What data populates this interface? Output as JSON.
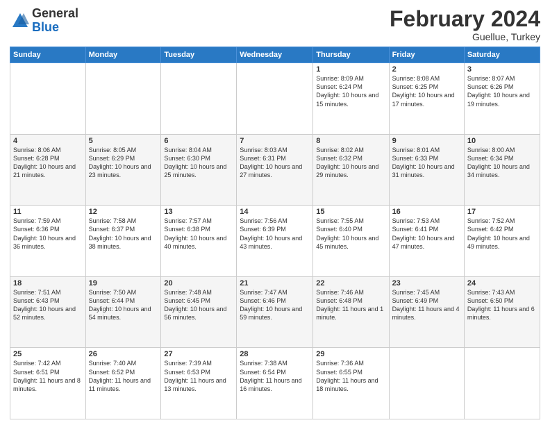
{
  "header": {
    "logo_general": "General",
    "logo_blue": "Blue",
    "month_title": "February 2024",
    "subtitle": "Guellue, Turkey"
  },
  "weekdays": [
    "Sunday",
    "Monday",
    "Tuesday",
    "Wednesday",
    "Thursday",
    "Friday",
    "Saturday"
  ],
  "weeks": [
    [
      {
        "day": "",
        "sunrise": "",
        "sunset": "",
        "daylight": ""
      },
      {
        "day": "",
        "sunrise": "",
        "sunset": "",
        "daylight": ""
      },
      {
        "day": "",
        "sunrise": "",
        "sunset": "",
        "daylight": ""
      },
      {
        "day": "",
        "sunrise": "",
        "sunset": "",
        "daylight": ""
      },
      {
        "day": "1",
        "sunrise": "Sunrise: 8:09 AM",
        "sunset": "Sunset: 6:24 PM",
        "daylight": "Daylight: 10 hours and 15 minutes."
      },
      {
        "day": "2",
        "sunrise": "Sunrise: 8:08 AM",
        "sunset": "Sunset: 6:25 PM",
        "daylight": "Daylight: 10 hours and 17 minutes."
      },
      {
        "day": "3",
        "sunrise": "Sunrise: 8:07 AM",
        "sunset": "Sunset: 6:26 PM",
        "daylight": "Daylight: 10 hours and 19 minutes."
      }
    ],
    [
      {
        "day": "4",
        "sunrise": "Sunrise: 8:06 AM",
        "sunset": "Sunset: 6:28 PM",
        "daylight": "Daylight: 10 hours and 21 minutes."
      },
      {
        "day": "5",
        "sunrise": "Sunrise: 8:05 AM",
        "sunset": "Sunset: 6:29 PM",
        "daylight": "Daylight: 10 hours and 23 minutes."
      },
      {
        "day": "6",
        "sunrise": "Sunrise: 8:04 AM",
        "sunset": "Sunset: 6:30 PM",
        "daylight": "Daylight: 10 hours and 25 minutes."
      },
      {
        "day": "7",
        "sunrise": "Sunrise: 8:03 AM",
        "sunset": "Sunset: 6:31 PM",
        "daylight": "Daylight: 10 hours and 27 minutes."
      },
      {
        "day": "8",
        "sunrise": "Sunrise: 8:02 AM",
        "sunset": "Sunset: 6:32 PM",
        "daylight": "Daylight: 10 hours and 29 minutes."
      },
      {
        "day": "9",
        "sunrise": "Sunrise: 8:01 AM",
        "sunset": "Sunset: 6:33 PM",
        "daylight": "Daylight: 10 hours and 31 minutes."
      },
      {
        "day": "10",
        "sunrise": "Sunrise: 8:00 AM",
        "sunset": "Sunset: 6:34 PM",
        "daylight": "Daylight: 10 hours and 34 minutes."
      }
    ],
    [
      {
        "day": "11",
        "sunrise": "Sunrise: 7:59 AM",
        "sunset": "Sunset: 6:36 PM",
        "daylight": "Daylight: 10 hours and 36 minutes."
      },
      {
        "day": "12",
        "sunrise": "Sunrise: 7:58 AM",
        "sunset": "Sunset: 6:37 PM",
        "daylight": "Daylight: 10 hours and 38 minutes."
      },
      {
        "day": "13",
        "sunrise": "Sunrise: 7:57 AM",
        "sunset": "Sunset: 6:38 PM",
        "daylight": "Daylight: 10 hours and 40 minutes."
      },
      {
        "day": "14",
        "sunrise": "Sunrise: 7:56 AM",
        "sunset": "Sunset: 6:39 PM",
        "daylight": "Daylight: 10 hours and 43 minutes."
      },
      {
        "day": "15",
        "sunrise": "Sunrise: 7:55 AM",
        "sunset": "Sunset: 6:40 PM",
        "daylight": "Daylight: 10 hours and 45 minutes."
      },
      {
        "day": "16",
        "sunrise": "Sunrise: 7:53 AM",
        "sunset": "Sunset: 6:41 PM",
        "daylight": "Daylight: 10 hours and 47 minutes."
      },
      {
        "day": "17",
        "sunrise": "Sunrise: 7:52 AM",
        "sunset": "Sunset: 6:42 PM",
        "daylight": "Daylight: 10 hours and 49 minutes."
      }
    ],
    [
      {
        "day": "18",
        "sunrise": "Sunrise: 7:51 AM",
        "sunset": "Sunset: 6:43 PM",
        "daylight": "Daylight: 10 hours and 52 minutes."
      },
      {
        "day": "19",
        "sunrise": "Sunrise: 7:50 AM",
        "sunset": "Sunset: 6:44 PM",
        "daylight": "Daylight: 10 hours and 54 minutes."
      },
      {
        "day": "20",
        "sunrise": "Sunrise: 7:48 AM",
        "sunset": "Sunset: 6:45 PM",
        "daylight": "Daylight: 10 hours and 56 minutes."
      },
      {
        "day": "21",
        "sunrise": "Sunrise: 7:47 AM",
        "sunset": "Sunset: 6:46 PM",
        "daylight": "Daylight: 10 hours and 59 minutes."
      },
      {
        "day": "22",
        "sunrise": "Sunrise: 7:46 AM",
        "sunset": "Sunset: 6:48 PM",
        "daylight": "Daylight: 11 hours and 1 minute."
      },
      {
        "day": "23",
        "sunrise": "Sunrise: 7:45 AM",
        "sunset": "Sunset: 6:49 PM",
        "daylight": "Daylight: 11 hours and 4 minutes."
      },
      {
        "day": "24",
        "sunrise": "Sunrise: 7:43 AM",
        "sunset": "Sunset: 6:50 PM",
        "daylight": "Daylight: 11 hours and 6 minutes."
      }
    ],
    [
      {
        "day": "25",
        "sunrise": "Sunrise: 7:42 AM",
        "sunset": "Sunset: 6:51 PM",
        "daylight": "Daylight: 11 hours and 8 minutes."
      },
      {
        "day": "26",
        "sunrise": "Sunrise: 7:40 AM",
        "sunset": "Sunset: 6:52 PM",
        "daylight": "Daylight: 11 hours and 11 minutes."
      },
      {
        "day": "27",
        "sunrise": "Sunrise: 7:39 AM",
        "sunset": "Sunset: 6:53 PM",
        "daylight": "Daylight: 11 hours and 13 minutes."
      },
      {
        "day": "28",
        "sunrise": "Sunrise: 7:38 AM",
        "sunset": "Sunset: 6:54 PM",
        "daylight": "Daylight: 11 hours and 16 minutes."
      },
      {
        "day": "29",
        "sunrise": "Sunrise: 7:36 AM",
        "sunset": "Sunset: 6:55 PM",
        "daylight": "Daylight: 11 hours and 18 minutes."
      },
      {
        "day": "",
        "sunrise": "",
        "sunset": "",
        "daylight": ""
      },
      {
        "day": "",
        "sunrise": "",
        "sunset": "",
        "daylight": ""
      }
    ]
  ]
}
